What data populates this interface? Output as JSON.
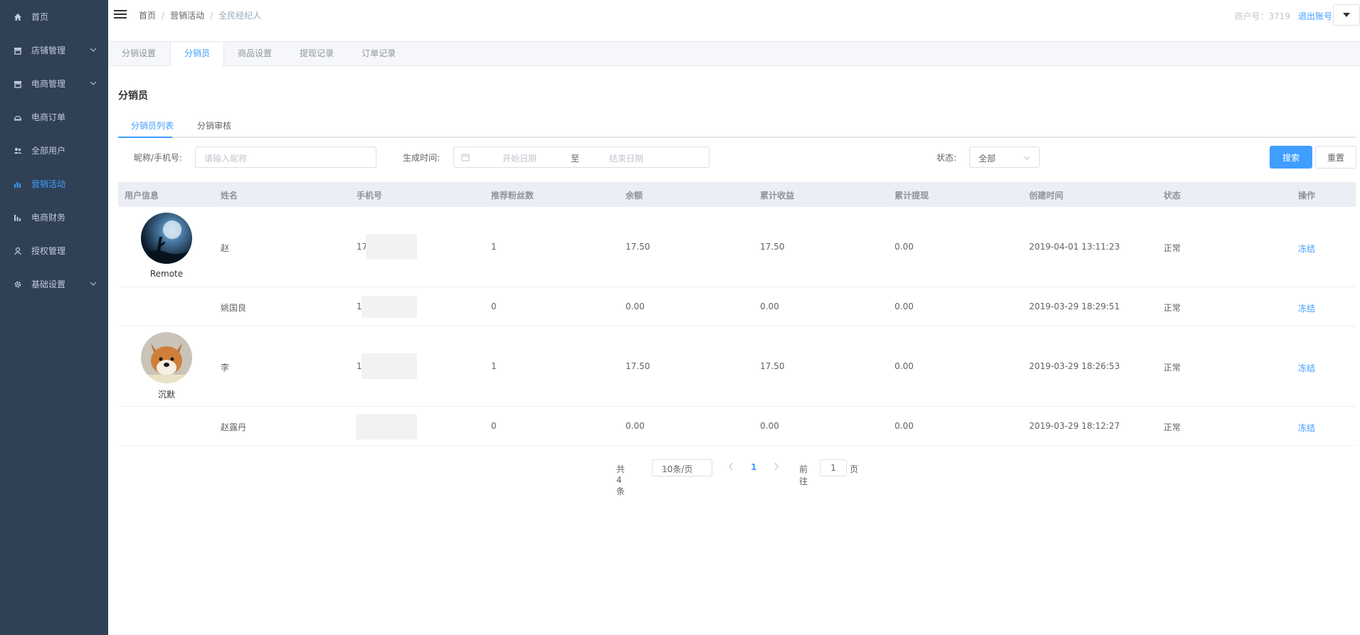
{
  "sidebar": {
    "items": [
      {
        "label": "首页",
        "icon": "home-icon"
      },
      {
        "label": "店铺管理",
        "icon": "store-icon",
        "expandable": true
      },
      {
        "label": "电商管理",
        "icon": "store-icon",
        "expandable": true
      },
      {
        "label": "电商订单",
        "icon": "cloche-icon"
      },
      {
        "label": "全部用户",
        "icon": "users-icon"
      },
      {
        "label": "营销活动",
        "icon": "chart-icon",
        "active": true
      },
      {
        "label": "电商财务",
        "icon": "finance-icon"
      },
      {
        "label": "授权管理",
        "icon": "user-icon"
      },
      {
        "label": "基础设置",
        "icon": "gear-icon",
        "expandable": true
      }
    ]
  },
  "header": {
    "breadcrumb": [
      "首页",
      "营销活动",
      "全民经纪人"
    ],
    "breadcrumb_sep": "/",
    "merchant": "商户号：3719",
    "logout": "退出账号"
  },
  "top_tabs": [
    {
      "label": "分销设置"
    },
    {
      "label": "分销员",
      "active": true
    },
    {
      "label": "商品设置"
    },
    {
      "label": "提现记录"
    },
    {
      "label": "订单记录"
    }
  ],
  "page_title": "分销员",
  "sub_tabs": [
    {
      "label": "分销员列表",
      "active": true
    },
    {
      "label": "分销审核"
    }
  ],
  "filters": {
    "nickname_label": "昵称/手机号:",
    "nickname_placeholder": "请输入昵称",
    "time_label": "生成时间:",
    "start_placeholder": "开始日期",
    "range_sep": "至",
    "end_placeholder": "结束日期",
    "status_label": "状态:",
    "status_value": "全部",
    "search_button": "搜索",
    "reset_button": "重置"
  },
  "table": {
    "columns": [
      "用户信息",
      "姓名",
      "手机号",
      "推荐粉丝数",
      "余额",
      "累计收益",
      "累计提现",
      "创建时间",
      "状态",
      "操作"
    ],
    "rows": [
      {
        "nickname": "Remote",
        "avatar": "moon-avatar",
        "name": "赵",
        "phone": "17",
        "fans": "1",
        "balance": "17.50",
        "income": "17.50",
        "withdrawn": "0.00",
        "created": "2019-04-01 13:11:23",
        "status": "正常",
        "action": "冻结"
      },
      {
        "nickname": "",
        "avatar": "",
        "name": "姚国良",
        "phone": "1",
        "fans": "0",
        "balance": "0.00",
        "income": "0.00",
        "withdrawn": "0.00",
        "created": "2019-03-29 18:29:51",
        "status": "正常",
        "action": "冻结"
      },
      {
        "nickname": "沉默",
        "avatar": "dog-avatar",
        "name": "李",
        "phone": "1",
        "fans": "1",
        "balance": "17.50",
        "income": "17.50",
        "withdrawn": "0.00",
        "created": "2019-03-29 18:26:53",
        "status": "正常",
        "action": "冻结"
      },
      {
        "nickname": "",
        "avatar": "",
        "name": "赵露丹",
        "phone": "",
        "fans": "0",
        "balance": "0.00",
        "income": "0.00",
        "withdrawn": "0.00",
        "created": "2019-03-29 18:12:27",
        "status": "正常",
        "action": "冻结"
      }
    ]
  },
  "pagination": {
    "total": "共 4 条",
    "page_size": "10条/页",
    "current_page": "1",
    "goto_label": "前往",
    "goto_value": "1",
    "page_label": "页"
  },
  "colors": {
    "sidebar_bg": "#304156",
    "accent": "#409eff"
  }
}
